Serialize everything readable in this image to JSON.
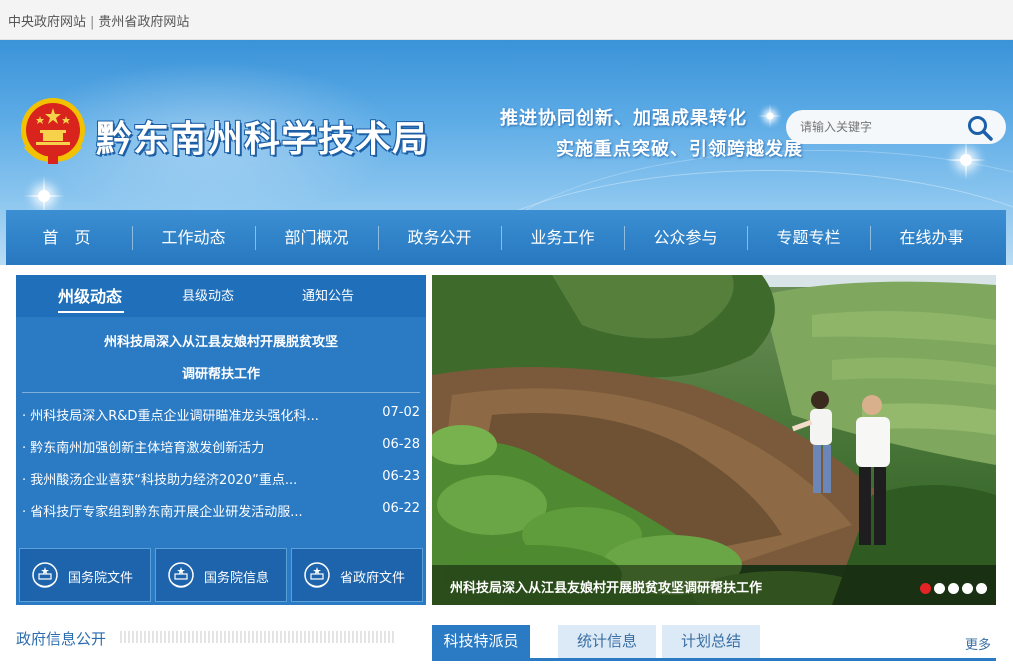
{
  "topbar": {
    "link1": "中央政府网站",
    "separator": "|",
    "link2": "贵州省政府网站"
  },
  "header": {
    "site_title": "黔东南州科学技术局",
    "slogan_line1": "推进协同创新、加强成果转化",
    "slogan_line2": "实施重点突破、引领跨越发展",
    "search_placeholder": "请输入关键字"
  },
  "nav": {
    "items": [
      "首　页",
      "工作动态",
      "部门概况",
      "政务公开",
      "业务工作",
      "公众参与",
      "专题专栏",
      "在线办事"
    ]
  },
  "news": {
    "tabs": [
      "州级动态",
      "县级动态",
      "通知公告"
    ],
    "active_tab": 0,
    "headline_line1": "州科技局深入从江县友娘村开展脱贫攻坚",
    "headline_line2": "调研帮扶工作",
    "items": [
      {
        "title": "· 州科技局深入R&D重点企业调研瞄准龙头强化科...",
        "date": "07-02"
      },
      {
        "title": "· 黔东南州加强创新主体培育激发创新活力",
        "date": "06-28"
      },
      {
        "title": "· 我州酸汤企业喜获“科技助力经济2020”重点...",
        "date": "06-23"
      },
      {
        "title": "· 省科技厅专家组到黔东南开展企业研发活动服...",
        "date": "06-22"
      }
    ]
  },
  "quick_links": [
    "国务院文件",
    "国务院信息",
    "省政府文件"
  ],
  "slider": {
    "caption": "州科技局深入从江县友娘村开展脱贫攻坚调研帮扶工作",
    "dot_count": 5,
    "active_dot": 0
  },
  "gov_info": {
    "title": "政府信息公开"
  },
  "bottom_tabs": {
    "tabs": [
      "科技特派员",
      "统计信息",
      "计划总结"
    ],
    "active_tab": 0,
    "more": "更多"
  },
  "colors": {
    "primary": "#2b7ac4",
    "nav_bg": "#2878c0",
    "active_dot": "#e32424"
  }
}
